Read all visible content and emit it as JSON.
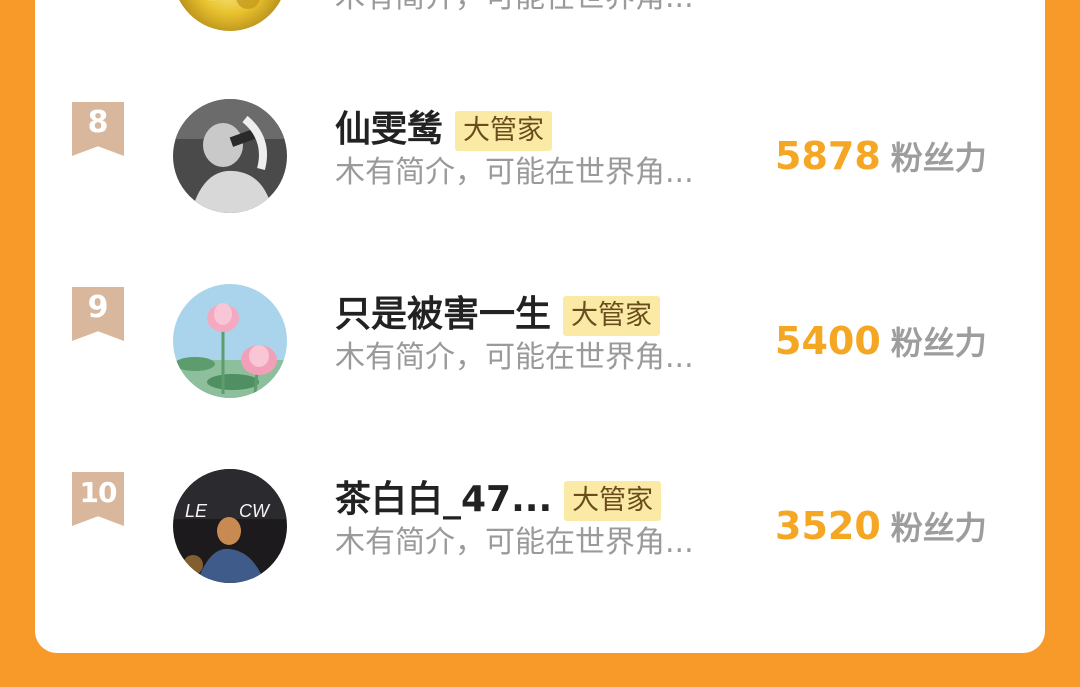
{
  "rows": [
    {
      "rank": "",
      "name": "",
      "badge": "",
      "bio": "木有简介，可能在世界角...",
      "fans": "",
      "fans_unit": "",
      "avatar_icon": "gold-avatar-icon"
    },
    {
      "rank": "8",
      "name": "仙雯鸶",
      "badge": "大管家",
      "bio": "木有简介，可能在世界角...",
      "fans": "5878",
      "fans_unit": "粉丝力",
      "avatar_icon": "grayscale-person-avatar-icon"
    },
    {
      "rank": "9",
      "name": "只是被害一生",
      "badge": "大管家",
      "bio": "木有简介，可能在世界角...",
      "fans": "5400",
      "fans_unit": "粉丝力",
      "avatar_icon": "lotus-flower-avatar-icon"
    },
    {
      "rank": "10",
      "name": "茶白白_47...",
      "badge": "大管家",
      "bio": "木有简介，可能在世界角...",
      "fans": "3520",
      "fans_unit": "粉丝力",
      "avatar_icon": "night-neon-avatar-icon"
    }
  ],
  "colors": {
    "background": "#f89a2a",
    "card": "#ffffff",
    "rank_badge": "#d9b79c",
    "fans_number": "#f5a623",
    "role_badge_bg": "#fbeaa6"
  }
}
